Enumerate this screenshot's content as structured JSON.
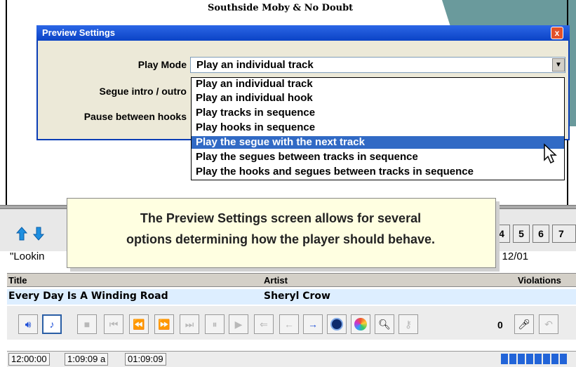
{
  "background": {
    "song_title": "Southside Moby & No Doubt",
    "looking_text": "\"Lookin",
    "date_label": "n  12/01",
    "number_buttons": [
      "4",
      "5",
      "6",
      "7"
    ],
    "table": {
      "columns": [
        "Title",
        "Artist",
        "Violations"
      ],
      "rows": [
        {
          "title": "Every Day Is A Winding Road",
          "artist": "Sheryl Crow",
          "violations": ""
        }
      ]
    },
    "counter": "0",
    "status": {
      "time": "12:00:00",
      "elapsed": "1:09:09 a",
      "remaining": "01:09:09"
    },
    "colors": {
      "accent": "#316ac5",
      "progress": "#2264d8"
    }
  },
  "dialog": {
    "title": "Preview Settings",
    "close_label": "x",
    "play_mode_label": "Play Mode",
    "play_mode_value": "Play an individual track",
    "segue_label": "Segue intro / outro",
    "pause_label": "Pause between hooks",
    "options": [
      "Play an individual track",
      "Play an individual hook",
      "Play tracks in sequence",
      "Play hooks in sequence",
      "Play the segue with the next track",
      "Play the segues between tracks in sequence",
      "Play the hooks and segues between tracks in sequence"
    ],
    "highlighted_index": 4
  },
  "callout": {
    "line1": "The Preview Settings screen allows for several",
    "line2": "options determining how the player should behave."
  }
}
